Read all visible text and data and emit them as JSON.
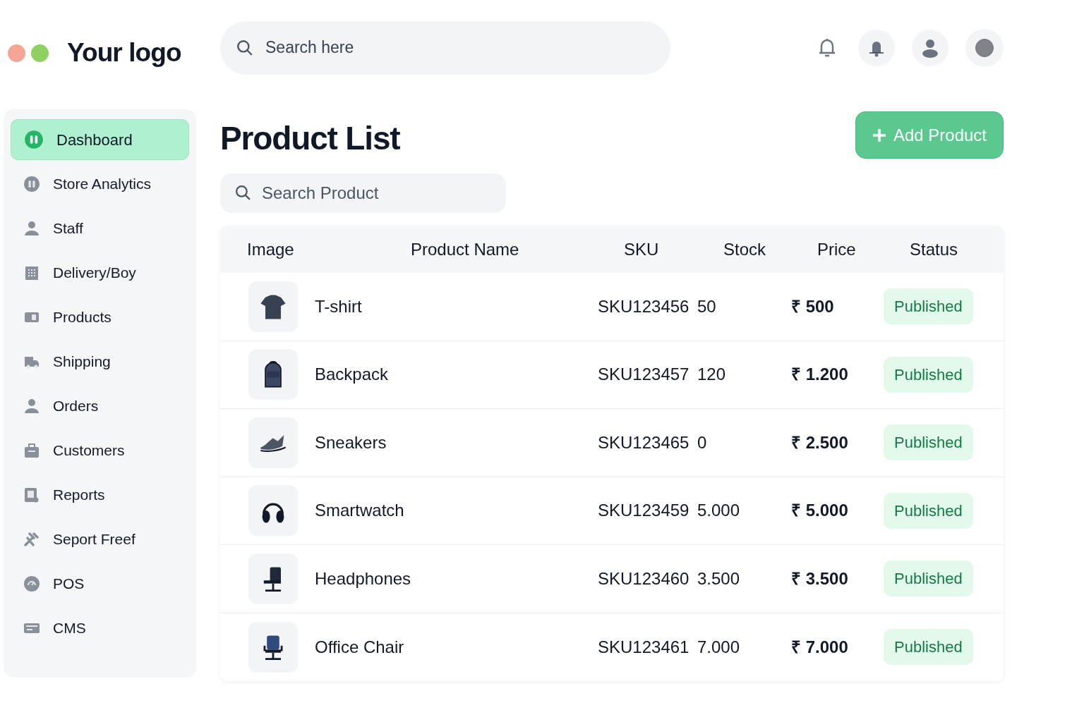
{
  "logo": {
    "text": "Your logo"
  },
  "header_search": {
    "placeholder": "Search here"
  },
  "sidebar": {
    "items": [
      {
        "label": "Dashboard",
        "selected": true
      },
      {
        "label": "Store Analytics",
        "selected": false
      },
      {
        "label": "Staff",
        "selected": false
      },
      {
        "label": "Delivery/Boy",
        "selected": false
      },
      {
        "label": "Products",
        "selected": false
      },
      {
        "label": "Shipping",
        "selected": false
      },
      {
        "label": "Orders",
        "selected": false
      },
      {
        "label": "Customers",
        "selected": false
      },
      {
        "label": "Reports",
        "selected": false
      },
      {
        "label": "Seport Freef",
        "selected": false
      },
      {
        "label": "POS",
        "selected": false
      },
      {
        "label": "CMS",
        "selected": false
      }
    ]
  },
  "page": {
    "title": "Product List",
    "add_button": "Add Product",
    "search": {
      "placeholder": "Search Product"
    }
  },
  "table": {
    "columns": [
      "Image",
      "Product Name",
      "SKU",
      "Stock",
      "Price",
      "Status"
    ],
    "rows": [
      {
        "name": "T-shirt",
        "sku": "SKU123456",
        "stock": "50",
        "price": "₹ 500",
        "status": "Published"
      },
      {
        "name": "Backpack",
        "sku": "SKU123457",
        "stock": "120",
        "price": "₹ 1.200",
        "status": "Published"
      },
      {
        "name": "Sneakers",
        "sku": "SKU123465",
        "stock": "0",
        "price": "₹ 2.500",
        "status": "Published"
      },
      {
        "name": "Smartwatch",
        "sku": "SKU123459",
        "stock": "5.000",
        "price": "₹ 5.000",
        "status": "Published"
      },
      {
        "name": "Headphones",
        "sku": "SKU123460",
        "stock": "3.500",
        "price": "₹ 3.500",
        "status": "Published"
      },
      {
        "name": "Office Chair",
        "sku": "SKU123461",
        "stock": "7.000",
        "price": "₹ 7.000",
        "status": "Published"
      }
    ]
  }
}
